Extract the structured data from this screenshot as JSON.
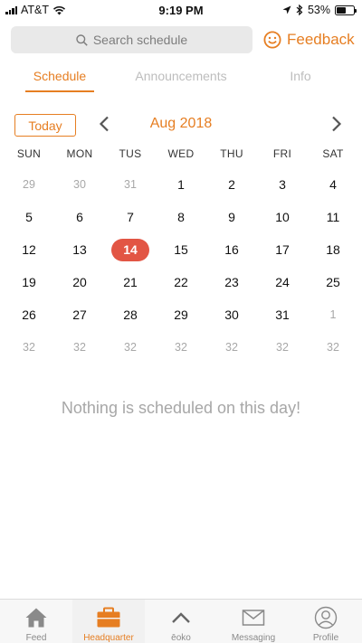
{
  "status_bar": {
    "carrier": "AT&T",
    "time": "9:19 PM",
    "battery_text": "53%",
    "battery_level": 0.53,
    "icons": [
      "signal-icon",
      "wifi-icon",
      "location-arrow-icon",
      "bluetooth-icon",
      "battery-icon"
    ]
  },
  "header": {
    "search_placeholder": "Search schedule",
    "feedback_label": "Feedback",
    "accent_color": "#e67e22"
  },
  "tabs": [
    {
      "label": "Schedule",
      "active": true
    },
    {
      "label": "Announcements",
      "active": false
    },
    {
      "label": "Info",
      "active": false
    }
  ],
  "calendar": {
    "today_label": "Today",
    "month_label": "Aug 2018",
    "weekdays": [
      "SUN",
      "MON",
      "TUS",
      "WED",
      "THU",
      "FRI",
      "SAT"
    ],
    "selected_day": "14",
    "selected_color": "#e25544",
    "days": [
      {
        "label": "29",
        "current": false
      },
      {
        "label": "30",
        "current": false
      },
      {
        "label": "31",
        "current": false
      },
      {
        "label": "1",
        "current": true
      },
      {
        "label": "2",
        "current": true
      },
      {
        "label": "3",
        "current": true
      },
      {
        "label": "4",
        "current": true
      },
      {
        "label": "5",
        "current": true
      },
      {
        "label": "6",
        "current": true
      },
      {
        "label": "7",
        "current": true
      },
      {
        "label": "8",
        "current": true
      },
      {
        "label": "9",
        "current": true
      },
      {
        "label": "10",
        "current": true
      },
      {
        "label": "11",
        "current": true
      },
      {
        "label": "12",
        "current": true
      },
      {
        "label": "13",
        "current": true
      },
      {
        "label": "14",
        "current": true,
        "selected": true
      },
      {
        "label": "15",
        "current": true
      },
      {
        "label": "16",
        "current": true
      },
      {
        "label": "17",
        "current": true
      },
      {
        "label": "18",
        "current": true
      },
      {
        "label": "19",
        "current": true
      },
      {
        "label": "20",
        "current": true
      },
      {
        "label": "21",
        "current": true
      },
      {
        "label": "22",
        "current": true
      },
      {
        "label": "23",
        "current": true
      },
      {
        "label": "24",
        "current": true
      },
      {
        "label": "25",
        "current": true
      },
      {
        "label": "26",
        "current": true
      },
      {
        "label": "27",
        "current": true
      },
      {
        "label": "28",
        "current": true
      },
      {
        "label": "29",
        "current": true
      },
      {
        "label": "30",
        "current": true
      },
      {
        "label": "31",
        "current": true
      },
      {
        "label": "1",
        "current": false
      },
      {
        "label": "32",
        "current": false
      },
      {
        "label": "32",
        "current": false
      },
      {
        "label": "32",
        "current": false
      },
      {
        "label": "32",
        "current": false
      },
      {
        "label": "32",
        "current": false
      },
      {
        "label": "32",
        "current": false
      },
      {
        "label": "32",
        "current": false
      }
    ]
  },
  "empty_message": "Nothing is scheduled on this day!",
  "tabbar": {
    "items": [
      {
        "label": "Feed",
        "icon": "home-icon",
        "active": false
      },
      {
        "label": "Headquarter",
        "icon": "briefcase-icon",
        "active": true
      },
      {
        "label": "ēoko",
        "icon": "chevron-up-icon",
        "active": false
      },
      {
        "label": "Messaging",
        "icon": "envelope-icon",
        "active": false
      },
      {
        "label": "Profile",
        "icon": "user-icon",
        "active": false
      }
    ]
  }
}
